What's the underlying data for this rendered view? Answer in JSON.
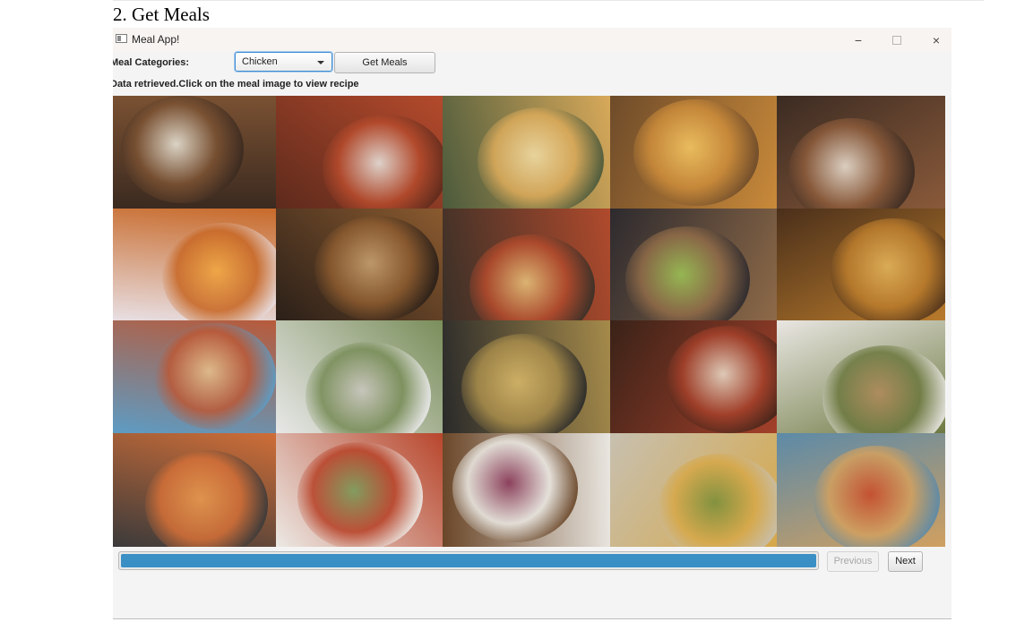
{
  "doc": {
    "heading": "2. Get Meals"
  },
  "window": {
    "title": "Meal App!",
    "controls": {
      "minimize": "−",
      "close": "×"
    }
  },
  "form": {
    "categories_label": "Meal Categories:",
    "category_selected": "Chicken",
    "get_meals_label": "Get Meals",
    "status_text": "Data retrieved.Click on the meal image to view recipe"
  },
  "meals": {
    "tiles": [
      {
        "icon": "meal-image",
        "colors": [
          "#3b2a20",
          "#7a5132",
          "#e9e4d6"
        ]
      },
      {
        "icon": "meal-image",
        "colors": [
          "#5d2a1c",
          "#b44a2c",
          "#e7e2dc"
        ]
      },
      {
        "icon": "meal-image",
        "colors": [
          "#4b5a3c",
          "#d8a95a",
          "#f0dba4"
        ]
      },
      {
        "icon": "meal-image",
        "colors": [
          "#6e4b2a",
          "#c98a3a",
          "#f2c563"
        ]
      },
      {
        "icon": "meal-image",
        "colors": [
          "#3b2b22",
          "#8a5a3a",
          "#e8ddd0"
        ]
      },
      {
        "icon": "meal-image",
        "colors": [
          "#e8dfe3",
          "#c86a2a",
          "#f0a640"
        ]
      },
      {
        "icon": "meal-image",
        "colors": [
          "#2a1f18",
          "#8a5a2f",
          "#c6a070"
        ]
      },
      {
        "icon": "meal-image",
        "colors": [
          "#3a3028",
          "#b04a2c",
          "#e6c07a"
        ]
      },
      {
        "icon": "meal-image",
        "colors": [
          "#2d2a2e",
          "#8e6a48",
          "#9cc255"
        ]
      },
      {
        "icon": "meal-image",
        "colors": [
          "#4a2f1a",
          "#b97b2c",
          "#e3b45c"
        ]
      },
      {
        "icon": "meal-image",
        "colors": [
          "#5d9cc4",
          "#b85a3a",
          "#e5c08c"
        ]
      },
      {
        "icon": "meal-image",
        "colors": [
          "#e8e8e8",
          "#7a8e5a",
          "#c9c6bd"
        ]
      },
      {
        "icon": "meal-image",
        "colors": [
          "#2a2a2a",
          "#a58a4a",
          "#d8b86a"
        ]
      },
      {
        "icon": "meal-image",
        "colors": [
          "#3a2218",
          "#a3402a",
          "#e8d9c6"
        ]
      },
      {
        "icon": "meal-image",
        "colors": [
          "#e9e6e2",
          "#6e7a42",
          "#b08a5a"
        ]
      },
      {
        "icon": "meal-image",
        "colors": [
          "#3b3a3a",
          "#cf6e38",
          "#e89a50"
        ]
      },
      {
        "icon": "meal-image",
        "colors": [
          "#ece9e4",
          "#b8462c",
          "#7a9c5a"
        ]
      },
      {
        "icon": "meal-image",
        "colors": [
          "#6a4628",
          "#e9e6e0",
          "#8a3a5a"
        ]
      },
      {
        "icon": "meal-image",
        "colors": [
          "#c7c0b0",
          "#d6a84a",
          "#7a8e3a"
        ]
      },
      {
        "icon": "meal-image",
        "colors": [
          "#5c8aa8",
          "#d0a060",
          "#c84a2a"
        ]
      }
    ]
  },
  "pagination": {
    "progress": 1.0,
    "previous_label": "Previous",
    "next_label": "Next",
    "accent": "#3a8fc4"
  }
}
